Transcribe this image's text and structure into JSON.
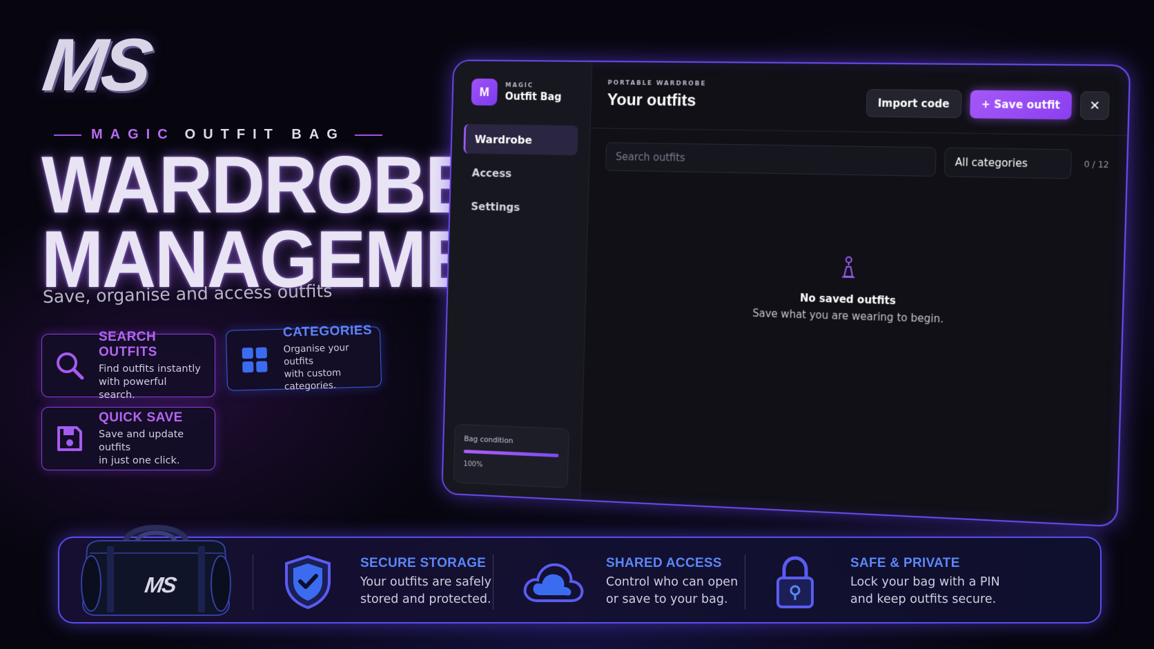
{
  "logo": {
    "text": "MS"
  },
  "hero": {
    "eyebrow_1": "MAGIC",
    "eyebrow_2": "OUTFIT BAG",
    "line_1": "WARDROBE",
    "line_2": "MANAGEMENT",
    "tagline": "Save, organise and access outfits"
  },
  "features": [
    {
      "title": "SEARCH OUTFITS",
      "desc_1": "Find outfits instantly",
      "desc_2": "with powerful search.",
      "icon": "search-icon"
    },
    {
      "title": "CATEGORIES",
      "desc_1": "Organise your outfits",
      "desc_2": "with custom categories.",
      "icon": "grid-icon"
    },
    {
      "title": "QUICK SAVE",
      "desc_1": "Save and update outfits",
      "desc_2": "in just one click.",
      "icon": "floppy-disk-icon"
    }
  ],
  "app": {
    "brand_badge": "M",
    "brand_small": "MAGIC",
    "brand_name": "Outfit Bag",
    "nav": [
      {
        "label": "Wardrobe",
        "active": true
      },
      {
        "label": "Access",
        "active": false
      },
      {
        "label": "Settings",
        "active": false
      }
    ],
    "condition": {
      "label": "Bag condition",
      "value_text": "100%",
      "value": 100
    },
    "kicker": "PORTABLE WARDROBE",
    "title": "Your outfits",
    "import_label": "Import code",
    "save_label": "+ Save outfit",
    "close_label": "✕",
    "search_placeholder": "Search outfits",
    "category_selected": "All categories",
    "counter": "0 / 12",
    "empty_title": "No saved outfits",
    "empty_sub": "Save what you are wearing to begin."
  },
  "bottom": {
    "bag_logo": "MS",
    "items": [
      {
        "title": "SECURE STORAGE",
        "desc_1": "Your outfits are safely",
        "desc_2": "stored and protected.",
        "icon": "shield-check-icon"
      },
      {
        "title": "SHARED ACCESS",
        "desc_1": "Control who can open",
        "desc_2": "or save to your bag.",
        "icon": "cloud-icon"
      },
      {
        "title": "SAFE &  PRIVATE",
        "desc_1": "Lock your bag with a PIN",
        "desc_2": "and keep outfits secure.",
        "icon": "padlock-icon"
      }
    ]
  },
  "colors": {
    "accent_purple": "#a152f6",
    "accent_blue": "#5c86f7",
    "background": "#07060f"
  }
}
